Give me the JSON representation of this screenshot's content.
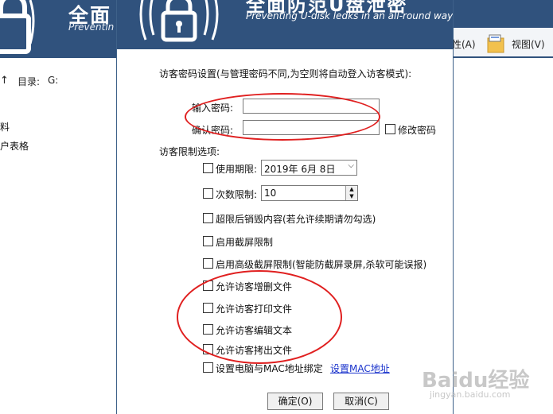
{
  "background": {
    "title": "全面",
    "subtitle": "Preventin",
    "toolbar": {
      "properties": "性(A)",
      "view": "视图(V)"
    },
    "address_label": "目录:",
    "address_value": "G:",
    "side_items": [
      "料",
      "户表格"
    ]
  },
  "dialog": {
    "title": "全面防范U盘泄密",
    "subtitle": "Preventing U-disk ledks in an all-round way",
    "intro": "访客密码设置(与管理密码不同,为空则将自动登入访客模式):",
    "password": {
      "label": "输入密码:",
      "value": ""
    },
    "confirm": {
      "label": "确认密码:",
      "value": ""
    },
    "modify_password": "修改密码",
    "restriction_heading": "访客限制选项:",
    "time_limit": {
      "label": "使用期限:",
      "date": "2019年 6月 8日"
    },
    "count_limit": {
      "label": "次数限制:",
      "value": "10"
    },
    "options": [
      "超限后销毁内容(若允许续期请勿勾选)",
      "启用截屏限制",
      "启用高级截屏限制(智能防截屏录屏,杀软可能误报)",
      "允许访客增删文件",
      "允许访客打印文件",
      "允许访客编辑文本",
      "允许访客拷出文件",
      "设置电脑与MAC地址绑定"
    ],
    "set_mac_link": "设置MAC地址",
    "ok_button": "确定(O)",
    "cancel_button": "取消(C)"
  },
  "watermark": {
    "brand": "Baidu经验",
    "url": "jingyan.baidu.com"
  },
  "colors": {
    "banner": "#30527d",
    "annotation": "#e02020",
    "link": "#1a33cc"
  }
}
